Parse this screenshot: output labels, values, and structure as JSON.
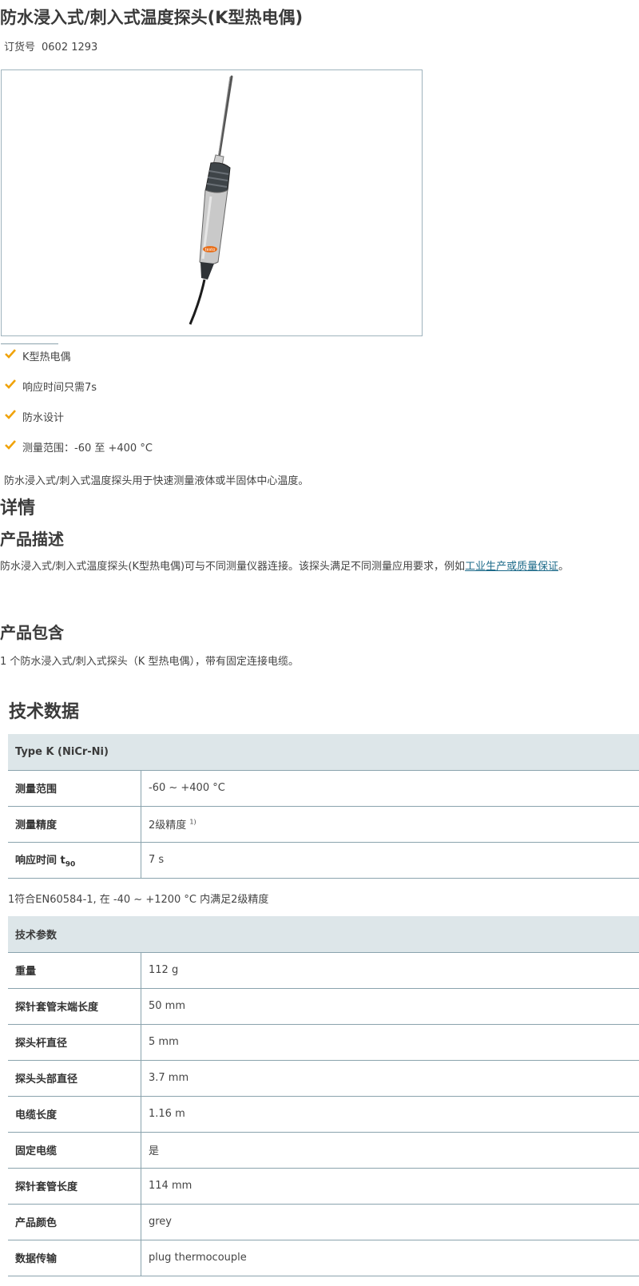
{
  "product": {
    "title": "防水浸入式/刺入式温度探头(K型热电偶)",
    "order_label": "订货号",
    "order_number": "0602 1293"
  },
  "image": {
    "brand_text": "testo"
  },
  "features": [
    {
      "icon": "check-icon",
      "text": "K型热电偶"
    },
    {
      "icon": "check-icon",
      "text": "响应时间只需7s"
    },
    {
      "icon": "check-icon",
      "text": "防水设计"
    },
    {
      "icon": "check-icon",
      "text": "测量范围：-60 至 +400 °C"
    }
  ],
  "intro": "防水浸入式/刺入式温度探头用于快速测量液体或半固体中心温度。",
  "details": {
    "heading": "详情",
    "desc_heading": "产品描述",
    "desc_text_before": "防水浸入式/刺入式温度探头(K型热电偶)可与不同测量仪器连接。该探头满足不同测量应用要求，例如",
    "desc_link": "工业生产或质量保证",
    "desc_text_after": "。",
    "contents_heading": "产品包含",
    "contents_text": "1 个防水浸入式/刺入式探头（K 型热电偶），带有固定连接电缆。"
  },
  "tech": {
    "heading": "技术数据",
    "table1": {
      "header": "Type K (NiCr-Ni)",
      "rows": [
        {
          "key": "测量范围",
          "value": "-60 ~ +400 °C"
        },
        {
          "key": "测量精度",
          "value": "2级精度",
          "value_sup": "1)"
        },
        {
          "key": "响应时间 t",
          "key_sub": "90",
          "value": "7 s"
        }
      ]
    },
    "footnote": "1符合EN60584-1, 在 -40 ~ +1200 °C 内满足2级精度",
    "table2": {
      "header": "技术参数",
      "rows": [
        {
          "key": "重量",
          "value": "112 g"
        },
        {
          "key": "探针套管末端长度",
          "value": "50 mm"
        },
        {
          "key": "探头杆直径",
          "value": "5 mm"
        },
        {
          "key": "探头头部直径",
          "value": "3.7 mm"
        },
        {
          "key": "电缆长度",
          "value": "1.16 m"
        },
        {
          "key": "固定电缆",
          "value": "是"
        },
        {
          "key": "探针套管长度",
          "value": "114 mm"
        },
        {
          "key": "产品颜色",
          "value": "grey"
        },
        {
          "key": "数据传输",
          "value": "plug thermocouple"
        }
      ]
    }
  },
  "colors": {
    "check": "#f0a30a",
    "table_header_bg": "#dde6e9",
    "border": "#8aa3ad",
    "link": "#1e6b8a"
  }
}
